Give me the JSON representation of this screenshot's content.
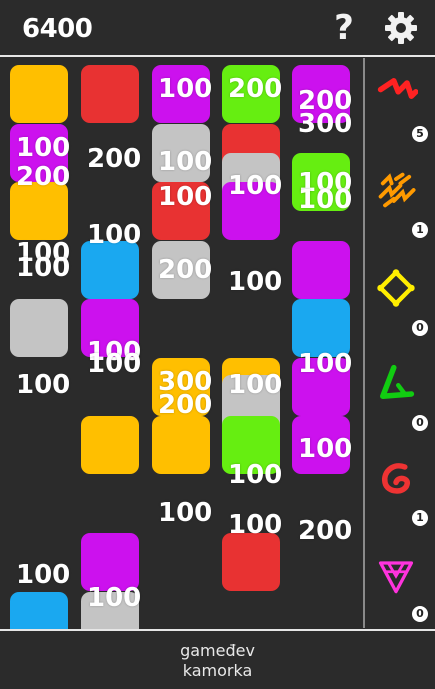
{
  "header": {
    "score": "6400",
    "help_label": "?"
  },
  "colors": {
    "yellow": "#ffbf00",
    "purple": "#cc11ee",
    "red": "#e83232",
    "grey": "#c4c4c4",
    "blue": "#1aa8f0",
    "green": "#66ee11"
  },
  "board": {
    "tiles": [
      {
        "col": 0,
        "row": 0,
        "color": "yellow"
      },
      {
        "col": 0,
        "row": 1,
        "color": "purple"
      },
      {
        "col": 0,
        "row": 2,
        "color": "yellow"
      },
      {
        "col": 0,
        "row": 4,
        "color": "grey"
      },
      {
        "col": 0,
        "row": 9,
        "color": "blue"
      },
      {
        "col": 1,
        "row": 0,
        "color": "red"
      },
      {
        "col": 1,
        "row": 3,
        "color": "blue"
      },
      {
        "col": 1,
        "row": 4,
        "color": "purple"
      },
      {
        "col": 1,
        "row": 6,
        "color": "yellow"
      },
      {
        "col": 1,
        "row": 8,
        "color": "purple"
      },
      {
        "col": 1,
        "row": 9,
        "color": "grey"
      },
      {
        "col": 2,
        "row": 0,
        "color": "purple"
      },
      {
        "col": 2,
        "row": 1,
        "color": "grey"
      },
      {
        "col": 2,
        "row": 2,
        "color": "red"
      },
      {
        "col": 2,
        "row": 3,
        "color": "grey"
      },
      {
        "col": 2,
        "row": 5,
        "color": "yellow"
      },
      {
        "col": 2,
        "row": 6,
        "color": "yellow"
      },
      {
        "col": 3,
        "row": 0,
        "color": "green"
      },
      {
        "col": 3,
        "row": 1,
        "color": "red"
      },
      {
        "col": 3,
        "row": 1.5,
        "color": "grey"
      },
      {
        "col": 3,
        "row": 2,
        "color": "purple"
      },
      {
        "col": 3,
        "row": 5,
        "color": "yellow"
      },
      {
        "col": 3,
        "row": 5.3,
        "color": "grey"
      },
      {
        "col": 3,
        "row": 6,
        "color": "green"
      },
      {
        "col": 3,
        "row": 8,
        "color": "red"
      },
      {
        "col": 4,
        "row": 0,
        "color": "purple"
      },
      {
        "col": 4,
        "row": 1.5,
        "color": "green"
      },
      {
        "col": 4,
        "row": 3,
        "color": "purple"
      },
      {
        "col": 4,
        "row": 4,
        "color": "blue"
      },
      {
        "col": 4,
        "row": 5,
        "color": "purple"
      },
      {
        "col": 4,
        "row": 6,
        "color": "purple"
      }
    ],
    "points": [
      {
        "text": "100",
        "col": 2,
        "row": -0.05
      },
      {
        "text": "200",
        "col": 3,
        "row": -0.05
      },
      {
        "text": "200",
        "col": 4,
        "row": 0.15
      },
      {
        "text": "300",
        "col": 4,
        "row": 0.55
      },
      {
        "text": "100",
        "col": 0,
        "row": 0.95
      },
      {
        "text": "200",
        "col": 1,
        "row": 1.15
      },
      {
        "text": "200",
        "col": 0,
        "row": 1.45
      },
      {
        "text": "100",
        "col": 2,
        "row": 1.2
      },
      {
        "text": "100",
        "col": 3,
        "row": 1.6
      },
      {
        "text": "100",
        "col": 4,
        "row": 1.55
      },
      {
        "text": "100",
        "col": 4,
        "row": 1.85
      },
      {
        "text": "100",
        "col": 2,
        "row": 1.8
      },
      {
        "text": "100",
        "col": 1,
        "row": 2.45
      },
      {
        "text": "100",
        "col": 0,
        "row": 2.75
      },
      {
        "text": "100",
        "col": 0,
        "row": 3.0
      },
      {
        "text": "200",
        "col": 2,
        "row": 3.05
      },
      {
        "text": "100",
        "col": 3,
        "row": 3.25
      },
      {
        "text": "100",
        "col": 1,
        "row": 4.45
      },
      {
        "text": "100",
        "col": 1,
        "row": 4.65
      },
      {
        "text": "100",
        "col": 4,
        "row": 4.65
      },
      {
        "text": "300",
        "col": 2,
        "row": 4.95
      },
      {
        "text": "100",
        "col": 3,
        "row": 5.0
      },
      {
        "text": "100",
        "col": 0,
        "row": 5.0
      },
      {
        "text": "200",
        "col": 2,
        "row": 5.35
      },
      {
        "text": "100",
        "col": 4,
        "row": 6.1
      },
      {
        "text": "100",
        "col": 3,
        "row": 6.55
      },
      {
        "text": "100",
        "col": 2,
        "row": 7.2
      },
      {
        "text": "100",
        "col": 3,
        "row": 7.4
      },
      {
        "text": "200",
        "col": 4,
        "row": 7.5
      },
      {
        "text": "100",
        "col": 0,
        "row": 8.25
      },
      {
        "text": "100",
        "col": 1,
        "row": 8.65
      }
    ]
  },
  "powerups": [
    {
      "name": "lightning-red",
      "count": "5",
      "color": "#ff2222"
    },
    {
      "name": "lightning-orange",
      "count": "1",
      "color": "#ff9a00"
    },
    {
      "name": "diamond-yellow",
      "count": "0",
      "color": "#ffee00"
    },
    {
      "name": "triangle-green",
      "count": "0",
      "color": "#11cc11"
    },
    {
      "name": "spiral-red",
      "count": "1",
      "color": "#ee3333"
    },
    {
      "name": "triangles-pink",
      "count": "0",
      "color": "#ff33dd"
    }
  ],
  "footer": {
    "line1": "gameđev",
    "line2": "kamorka"
  }
}
